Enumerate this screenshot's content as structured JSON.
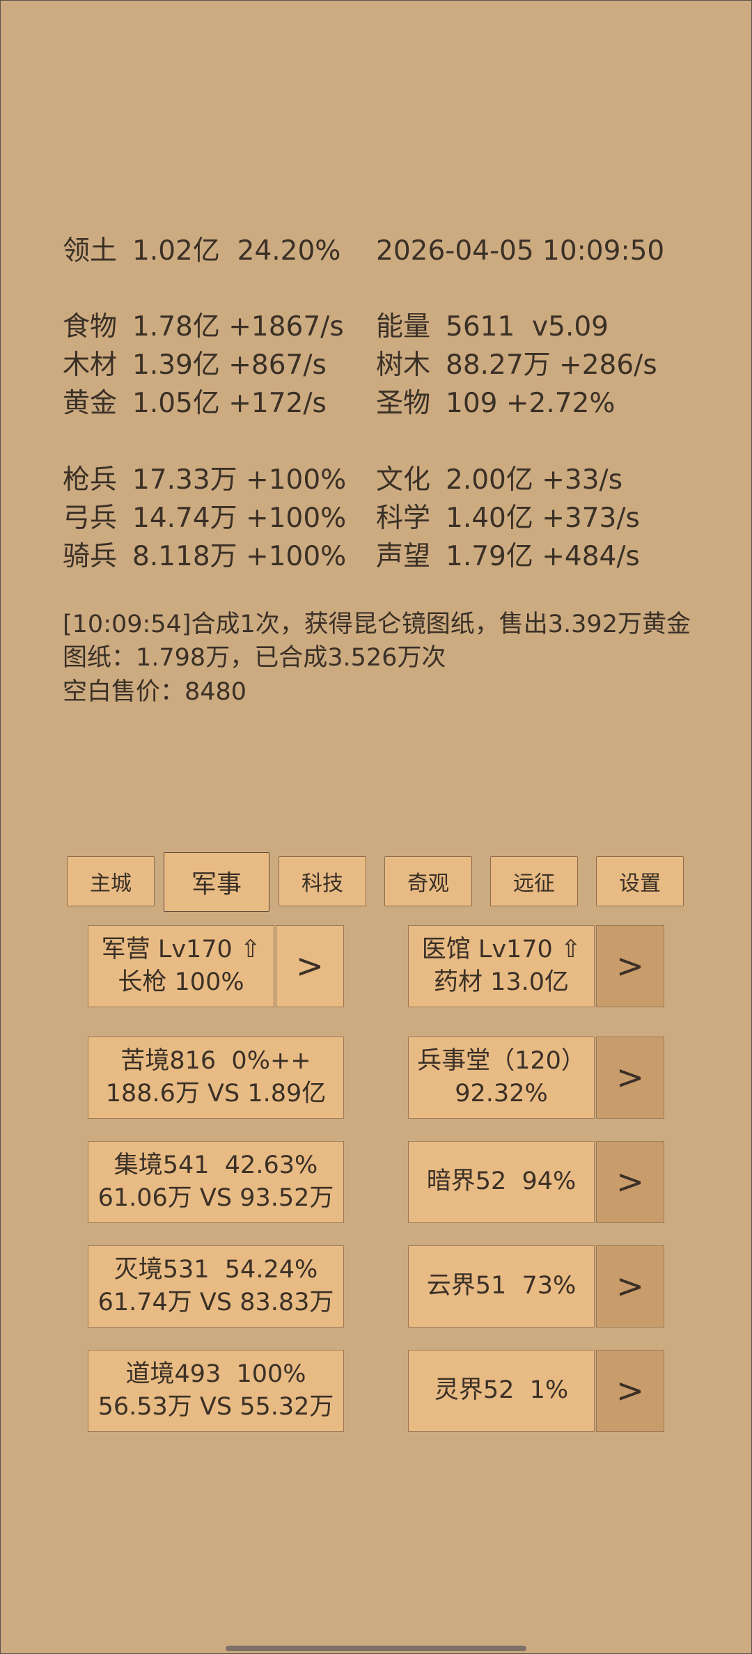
{
  "header": {
    "territory_label": "领土",
    "territory_value": "1.02亿  24.20%",
    "datetime": "2026-04-05 10:09:50"
  },
  "resources": {
    "food_label": "食物",
    "food_value": "1.78亿 +1867/s",
    "energy_label": "能量",
    "energy_value": "5611  v5.09",
    "wood_label": "木材",
    "wood_value": "1.39亿 +867/s",
    "trees_label": "树木",
    "trees_value": "88.27万 +286/s",
    "gold_label": "黄金",
    "gold_value": "1.05亿 +172/s",
    "relic_label": "圣物",
    "relic_value": "109 +2.72%"
  },
  "army": {
    "spear_label": "枪兵",
    "spear_value": "17.33万 +100%",
    "culture_label": "文化",
    "culture_value": "2.00亿 +33/s",
    "archer_label": "弓兵",
    "archer_value": "14.74万 +100%",
    "science_label": "科学",
    "science_value": "1.40亿 +373/s",
    "cavalry_label": "骑兵",
    "cavalry_value": "8.118万 +100%",
    "prestige_label": "声望",
    "prestige_value": "1.79亿 +484/s"
  },
  "log": {
    "line1": "[10:09:54]合成1次，获得昆仑镜图纸，售出3.392万黄金",
    "line2": "图纸：1.798万，已合成3.526万次",
    "line3": "空白售价：8480"
  },
  "tabs": [
    "主城",
    "军事",
    "科技",
    "奇观",
    "远征",
    "设置"
  ],
  "active_tab": "军事",
  "cards": {
    "barracks": {
      "line1": "军营 Lv170 ⇧",
      "line2": "长枪 100%"
    },
    "hospital": {
      "line1": "医馆 Lv170 ⇧",
      "line2": "药材 13.0亿"
    },
    "realm1": {
      "line1": "苦境816  0%++",
      "line2": "188.6万 VS 1.89亿"
    },
    "hall": {
      "line1": "兵事堂（120）",
      "line2": "92.32%"
    },
    "realm2": {
      "line1": "集境541  42.63%",
      "line2": "61.06万 VS 93.52万"
    },
    "dark": {
      "line1": "暗界52  94%"
    },
    "realm3": {
      "line1": "灭境531  54.24%",
      "line2": "61.74万 VS 83.83万"
    },
    "cloud": {
      "line1": "云界51  73%"
    },
    "realm4": {
      "line1": "道境493  100%",
      "line2": "56.53万 VS 55.32万"
    },
    "spirit": {
      "line1": "灵界52  1%"
    }
  },
  "arrow_label": ">",
  "icons": {
    "upgrade": "up-arrow-icon"
  },
  "colors": {
    "background": "#cdab81",
    "card": "#e8bb84",
    "card_dark": "#c99c6b",
    "text": "#3a3026"
  }
}
